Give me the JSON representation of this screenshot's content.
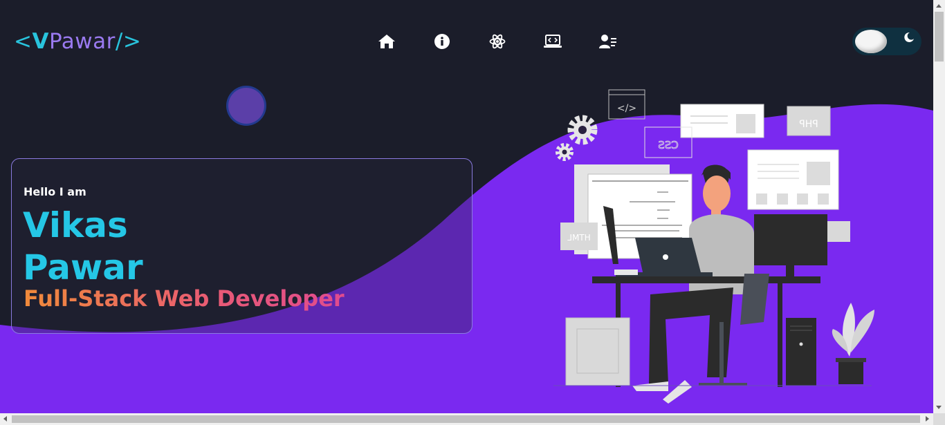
{
  "header": {
    "logo": {
      "open": "<",
      "initial": "V",
      "rest": "Pawar",
      "close": "/>"
    },
    "nav": [
      {
        "icon": "home-icon"
      },
      {
        "icon": "info-icon"
      },
      {
        "icon": "react-atom-icon"
      },
      {
        "icon": "laptop-code-icon"
      },
      {
        "icon": "user-list-icon"
      }
    ],
    "theme_toggle": {
      "icon": "moon-icon",
      "state": "dark"
    }
  },
  "hero": {
    "greeting": "Hello I am",
    "name_line1": "Vikas",
    "name_line2": "Pawar",
    "role": "Full-Stack Web Developer"
  },
  "illustration": {
    "labels": {
      "php": "PHP",
      "css": "CSS",
      "html": "HTML",
      "code_tag": "</>"
    }
  },
  "colors": {
    "background": "#1b1d2a",
    "accent_purple": "#7a29f0",
    "accent_cyan": "#25c7e6",
    "gradient_start": "#f08a3a",
    "gradient_end": "#e04b8f"
  }
}
